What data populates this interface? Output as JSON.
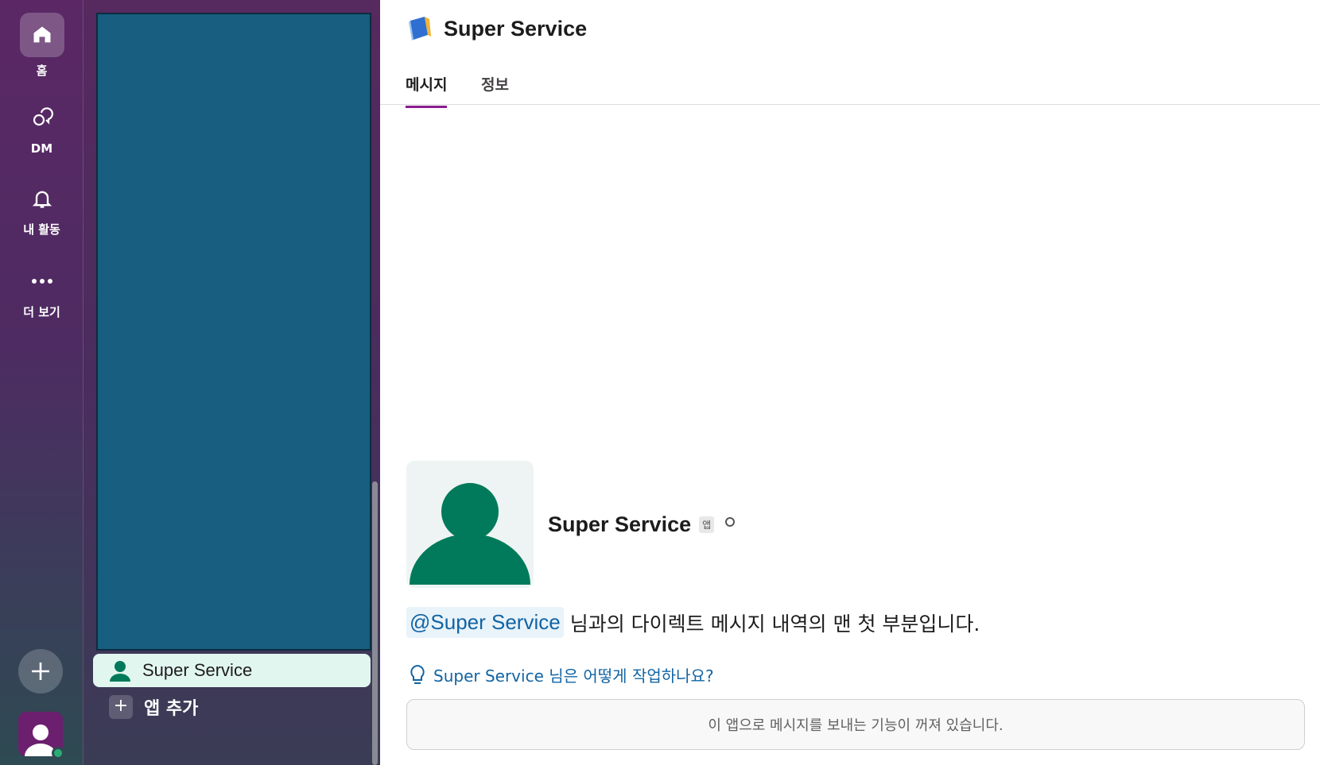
{
  "rail": {
    "items": [
      {
        "label": "홈",
        "icon": "home-icon"
      },
      {
        "label": "DM",
        "icon": "dm-icon"
      },
      {
        "label": "내 활동",
        "icon": "bell-icon"
      },
      {
        "label": "더 보기",
        "icon": "more-icon"
      }
    ]
  },
  "sidebar": {
    "dm_item": {
      "label": "Super Service",
      "icon": "user-icon"
    },
    "add_app": {
      "label": "앱 추가",
      "icon": "plus-icon"
    }
  },
  "main": {
    "title": "Super Service",
    "tabs": [
      {
        "label": "메시지"
      },
      {
        "label": "정보"
      }
    ],
    "profile": {
      "name": "Super Service",
      "badge": "앱"
    },
    "history": {
      "mention": "@Super Service",
      "text": "님과의 다이렉트 메시지 내역의 맨 첫 부분입니다."
    },
    "howto": "Super Service 님은 어떻게 작업하나요?",
    "disabled_notice": "이 앱으로 메시지를 보내는 기능이 꺼져 있습니다."
  },
  "colors": {
    "accent": "#8b1c8f",
    "link": "#1264a3",
    "avatar_green": "#007a5a",
    "presence": "#2bac76"
  }
}
